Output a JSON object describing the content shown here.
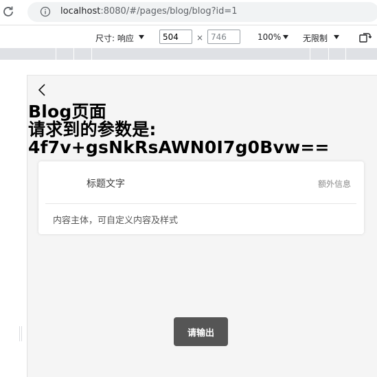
{
  "browser": {
    "url_host": "localhost",
    "url_rest": ":8080/#/pages/blog/blog?id=1"
  },
  "device_toolbar": {
    "dimensions_label": "尺寸: 响应",
    "width": "504",
    "height_placeholder": "746",
    "times": "×",
    "zoom": "100%",
    "throttle": "无限制"
  },
  "page": {
    "title": "Blog页面\n请求到的参数是:\n4f7v+gsNkRsAWN0I7g0Bvw==",
    "card": {
      "title": "标题文字",
      "extra": "额外信息",
      "body": "内容主体，可自定义内容及样式"
    },
    "output_button": "请输出"
  }
}
